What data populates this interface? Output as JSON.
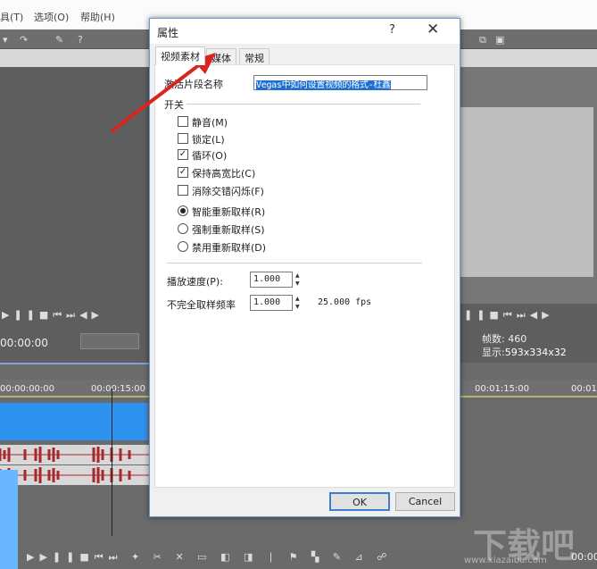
{
  "menu": {
    "items": [
      "具(T)",
      "选项(O)",
      "帮助(H)"
    ]
  },
  "dialog": {
    "title": "属性",
    "help": "?",
    "close": "✕",
    "tabs": [
      {
        "label": "视频素材",
        "active": true
      },
      {
        "label": "媒体",
        "active": false
      },
      {
        "label": "常规",
        "active": false
      }
    ],
    "name_label": "激活片段名称",
    "name_value": "Vegas中如何设置视频的格式-杜鑫",
    "switch_group": "开关",
    "checkboxes": [
      {
        "label": "静音(M)",
        "checked": false
      },
      {
        "label": "锁定(L)",
        "checked": false
      },
      {
        "label": "循环(O)",
        "checked": true
      },
      {
        "label": "保持高宽比(C)",
        "checked": true
      },
      {
        "label": "消除交错闪烁(F)",
        "checked": false
      }
    ],
    "radios": [
      {
        "label": "智能重新取样(R)",
        "selected": true
      },
      {
        "label": "强制重新取样(S)",
        "selected": false
      },
      {
        "label": "禁用重新取样(D)",
        "selected": false
      }
    ],
    "speed_label": "播放速度(P):",
    "speed_value": "1.000",
    "rate_label": "不完全取样频率",
    "rate_value": "1.000",
    "fps": "25.000 fps",
    "ok": "OK",
    "cancel": "Cancel"
  },
  "editor": {
    "timecode": "00:00:00",
    "frames": "帧数: 460",
    "display_label": "显示:",
    "display_value": "593x334x32",
    "ruler": [
      "00:00:00:00",
      "00:00:15:00",
      "00:01:15:00",
      "00:01:"
    ],
    "bottom_timecode": "00:00"
  },
  "watermark": {
    "text": "下载吧",
    "url": "www.xiazaiba.com"
  },
  "colors": {
    "accent": "#1e6fd0",
    "arrow": "#d9251d",
    "clip": "#2e93f0",
    "waveform": "#a8282a"
  }
}
